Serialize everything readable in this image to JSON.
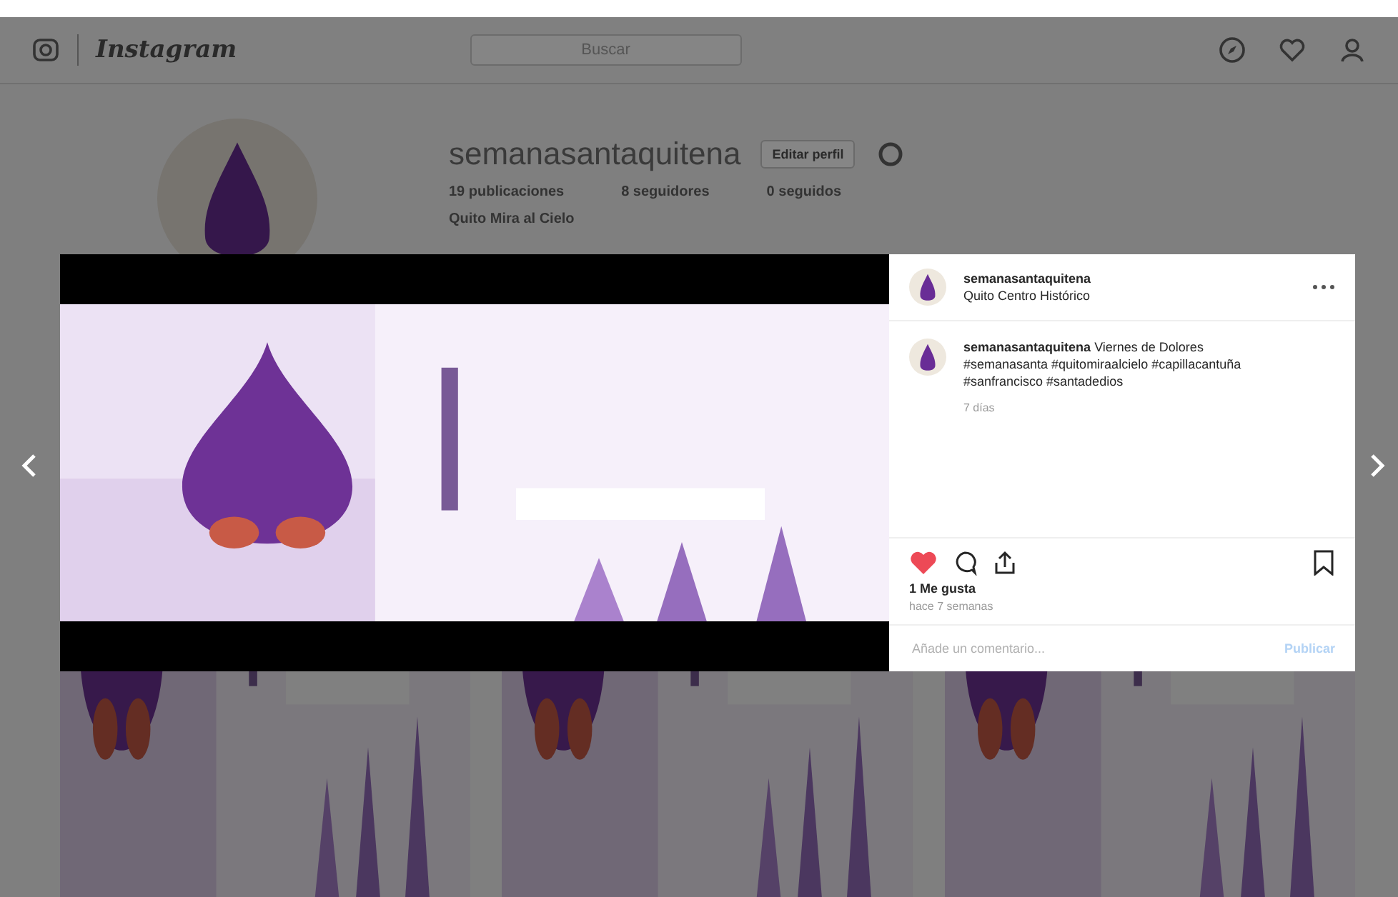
{
  "header": {
    "logo": "Instagram",
    "search": {
      "placeholder": "Buscar"
    }
  },
  "profile": {
    "username": "semanasantaquitena",
    "edit_button": "Editar perfil",
    "stats": [
      "19 publicaciones",
      "8 seguidores",
      "0 seguidos"
    ],
    "bio": "Quito Mira al Cielo"
  },
  "post": {
    "username": "semanasantaquitena",
    "location": "Quito Centro Histórico",
    "caption": {
      "username": "semanasantaquitena",
      "text": "Viernes de Dolores #semanasanta #quitomiraalcielo #capillacantuña #sanfrancisco #santadedios"
    },
    "caption_time": "7 días",
    "liked": true,
    "likes": "1 Me gusta",
    "time": "hace 7 semanas",
    "comment": {
      "placeholder": "Añade un comentario..."
    },
    "publish_button": "Publicar"
  }
}
